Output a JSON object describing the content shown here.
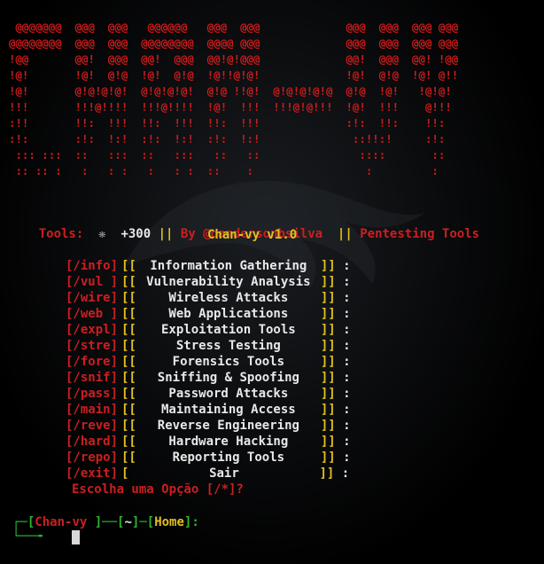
{
  "banner": {
    "ascii_lines": [
      " @@@@@@@  @@@  @@@   @@@@@@   @@@  @@@             @@@  @@@  @@@ @@@",
      "@@@@@@@@  @@@  @@@  @@@@@@@@  @@@@ @@@             @@@  @@@  @@@ @@@",
      "!@@       @@!  @@@  @@!  @@@  @@!@!@@@             @@!  @@@  @@! !@@",
      "!@!       !@!  @!@  !@!  @!@  !@!!@!@!             !@!  @!@  !@! @!!",
      "!@!       @!@!@!@!  @!@!@!@!  @!@ !!@!  @!@!@!@!@  @!@  !@!   !@!@!",
      "!!!       !!!@!!!!  !!!@!!!!  !@!  !!!  !!!@!@!!!  !@!  !!!    @!!!",
      ":!!       !!:  !!!  !!:  !!!  !!:  !!!             :!:  !!:    !!:",
      ":!:       :!:  !:!  :!:  !:!  :!:  !:!              ::!!:!     :!:",
      " ::: :::  ::   :::  ::   :::   ::   ::               ::::       ::",
      " :: :: :   :   : :   :   : :  ::    :                 :         :"
    ]
  },
  "header": {
    "tools_label": "Tools:",
    "star_icon": "❋",
    "count": "+300",
    "sep1": "||",
    "author": "By @oandersonbsilva",
    "sep2": "||",
    "suite": "Pentesting Tools",
    "title": "Chan-vy v1.0"
  },
  "menu": {
    "items": [
      {
        "cmd": "[/info]",
        "label": "Information Gathering"
      },
      {
        "cmd": "[/vul ]",
        "label": "Vulnerability Analysis"
      },
      {
        "cmd": "[/wire]",
        "label": "Wireless Attacks"
      },
      {
        "cmd": "[/web ]",
        "label": "Web Applications"
      },
      {
        "cmd": "[/expl]",
        "label": "Exploitation Tools"
      },
      {
        "cmd": "[/stre]",
        "label": "Stress Testing"
      },
      {
        "cmd": "[/fore]",
        "label": "Forensics Tools"
      },
      {
        "cmd": "[/snif]",
        "label": "Sniffing & Spoofing"
      },
      {
        "cmd": "[/pass]",
        "label": "Password Attacks"
      },
      {
        "cmd": "[/main]",
        "label": "Maintaining Access"
      },
      {
        "cmd": "[/reve]",
        "label": "Reverse Engineering"
      },
      {
        "cmd": "[/hard]",
        "label": "Hardware Hacking"
      },
      {
        "cmd": "[/repo]",
        "label": "Reporting Tools"
      },
      {
        "cmd": "[/exit]",
        "label": "Sair"
      }
    ],
    "open_bracket": "[[",
    "open_bracket_exit": "[",
    "close_bracket": "]]",
    "colon": ":",
    "choose_prompt": "Escolha uma Opção [/*]?"
  },
  "prompt": {
    "prefix": "┌─[",
    "user": "Chan-vy",
    "mid1": " ]──[",
    "path": "~",
    "mid2": "]─[",
    "home": "Home",
    "suffix": "]:",
    "second_line": "└──╼"
  },
  "colors": {
    "background": "#000000",
    "red": "#cc1f1f",
    "yellow": "#e0c020",
    "white": "#e8e8e8",
    "green": "#2db52d"
  }
}
